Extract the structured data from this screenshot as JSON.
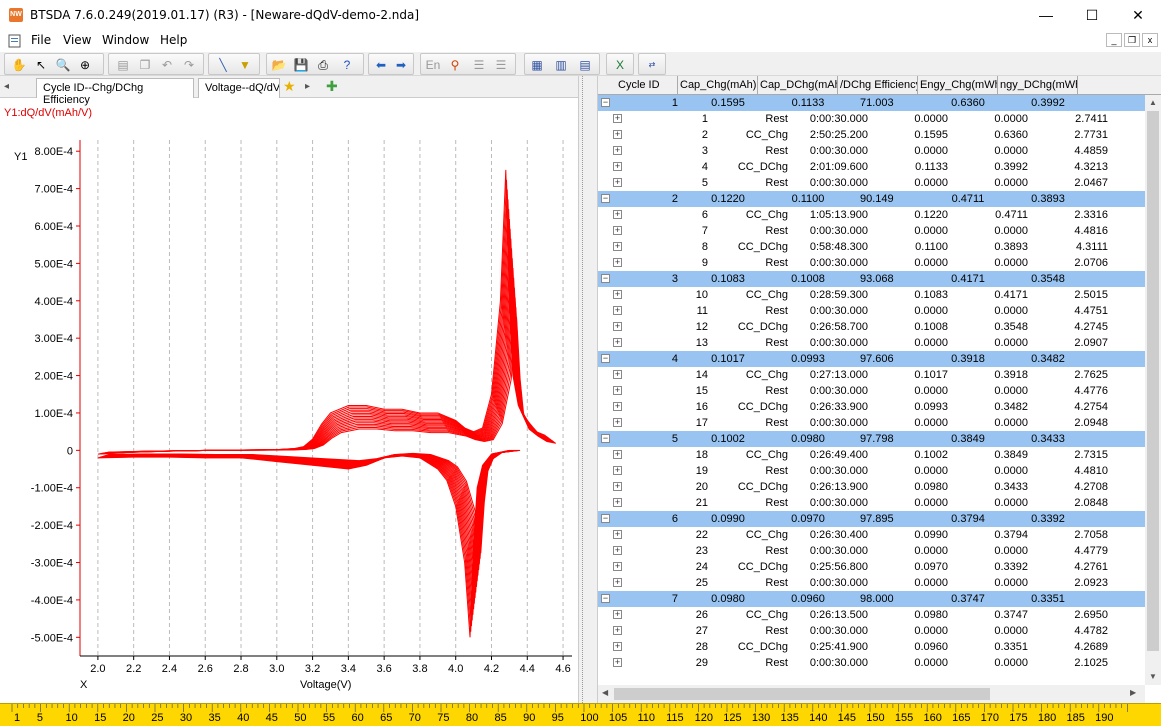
{
  "window": {
    "title": "BTSDA 7.6.0.249(2019.01.17) (R3) - [Neware-dQdV-demo-2.nda]",
    "icon_text": "NW",
    "min_glyph": "—",
    "max_glyph": "☐",
    "close_glyph": "✕"
  },
  "menu": {
    "items": [
      "File",
      "View",
      "Window",
      "Help"
    ],
    "mdi_min": "_",
    "mdi_restore": "❐",
    "mdi_close": "x"
  },
  "tabs": {
    "tab1": "Cycle ID--Chg/DChg Efficiency",
    "tab2": "Voltage--dQ/dV",
    "left_arrow": "◂",
    "right_arrow": "▸"
  },
  "chart_data": {
    "type": "line",
    "ylabel_top": "Y1:dQ/dV(mAh/V)",
    "y_axis_name": "Y1",
    "x_axis_name": "X",
    "xlabel": "Voltage(V)",
    "x_ticks": [
      "2.0",
      "2.2",
      "2.4",
      "2.6",
      "2.8",
      "3.0",
      "3.2",
      "3.4",
      "3.6",
      "3.8",
      "4.0",
      "4.2",
      "4.4",
      "4.6"
    ],
    "y_ticks": [
      "8.00E-4",
      "7.00E-4",
      "6.00E-4",
      "5.00E-4",
      "4.00E-4",
      "3.00E-4",
      "2.00E-4",
      "1.00E-4",
      "0",
      "-1.00E-4",
      "-2.00E-4",
      "-3.00E-4",
      "-4.00E-4",
      "-5.00E-4"
    ],
    "xlim": [
      1.9,
      4.65
    ],
    "ylim": [
      -0.00055,
      0.00083
    ],
    "grid": "vertical",
    "series_color": "#ff0000",
    "charge_curve": {
      "x": [
        2.0,
        2.2,
        2.4,
        2.6,
        2.8,
        3.0,
        3.1,
        3.15,
        3.2,
        3.25,
        3.3,
        3.4,
        3.5,
        3.6,
        3.7,
        3.8,
        3.9,
        4.0,
        4.05,
        4.1,
        4.15,
        4.2,
        4.22,
        4.25,
        4.28,
        4.3,
        4.32,
        4.35,
        4.4,
        4.45,
        4.5
      ],
      "y": [
        -1e-05,
        -5e-06,
        -2e-06,
        0.0,
        1e-06,
        2e-06,
        5e-06,
        1e-05,
        3e-05,
        7e-05,
        0.0001,
        0.00012,
        0.00012,
        0.00011,
        0.00011,
        0.0001,
        0.0001,
        8e-05,
        6e-05,
        5e-05,
        6e-05,
        0.00015,
        0.00025,
        0.0004,
        0.00075,
        0.0004,
        0.0002,
        0.00012,
        8e-05,
        5e-05,
        4e-05
      ]
    },
    "discharge_curve": {
      "x": [
        2.0,
        2.2,
        2.4,
        2.6,
        2.8,
        3.0,
        3.2,
        3.4,
        3.5,
        3.6,
        3.7,
        3.8,
        3.9,
        3.95,
        4.0,
        4.05,
        4.08,
        4.1,
        4.12,
        4.15,
        4.2,
        4.3
      ],
      "y": [
        -2e-05,
        -1.8e-05,
        -1.8e-05,
        -2e-05,
        -2e-05,
        -3e-05,
        -4e-05,
        -5e-05,
        -4e-05,
        -2e-05,
        -1.5e-05,
        -2e-05,
        -5e-05,
        -8e-05,
        -0.00015,
        -0.0003,
        -0.0005,
        -0.00025,
        -0.0001,
        -4e-05,
        -1e-05,
        0.0
      ]
    }
  },
  "grid": {
    "columns": [
      "Cycle ID",
      "Cap_Chg(mAh)",
      "Cap_DChg(mAh)",
      "/DChg Efficiency",
      "Engy_Chg(mWh)",
      "ngy_DChg(mWh"
    ],
    "rows": [
      {
        "type": "parent",
        "cycle": "1",
        "cap_chg": "0.1595",
        "cap_dchg": "0.1133",
        "eff": "71.003",
        "engy_chg": "0.6360",
        "engy_dchg": "0.3992"
      },
      {
        "type": "child",
        "id": "1",
        "step": "Rest",
        "time": "0:00:30.000",
        "cap": "0.0000",
        "engy": "0.0000",
        "v": "2.7411"
      },
      {
        "type": "child",
        "id": "2",
        "step": "CC_Chg",
        "time": "2:50:25.200",
        "cap": "0.1595",
        "engy": "0.6360",
        "v": "2.7731"
      },
      {
        "type": "child",
        "id": "3",
        "step": "Rest",
        "time": "0:00:30.000",
        "cap": "0.0000",
        "engy": "0.0000",
        "v": "4.4859"
      },
      {
        "type": "child",
        "id": "4",
        "step": "CC_DChg",
        "time": "2:01:09.600",
        "cap": "0.1133",
        "engy": "0.3992",
        "v": "4.3213"
      },
      {
        "type": "child",
        "id": "5",
        "step": "Rest",
        "time": "0:00:30.000",
        "cap": "0.0000",
        "engy": "0.0000",
        "v": "2.0467"
      },
      {
        "type": "parent",
        "cycle": "2",
        "cap_chg": "0.1220",
        "cap_dchg": "0.1100",
        "eff": "90.149",
        "engy_chg": "0.4711",
        "engy_dchg": "0.3893"
      },
      {
        "type": "child",
        "id": "6",
        "step": "CC_Chg",
        "time": "1:05:13.900",
        "cap": "0.1220",
        "engy": "0.4711",
        "v": "2.3316"
      },
      {
        "type": "child",
        "id": "7",
        "step": "Rest",
        "time": "0:00:30.000",
        "cap": "0.0000",
        "engy": "0.0000",
        "v": "4.4816"
      },
      {
        "type": "child",
        "id": "8",
        "step": "CC_DChg",
        "time": "0:58:48.300",
        "cap": "0.1100",
        "engy": "0.3893",
        "v": "4.3111"
      },
      {
        "type": "child",
        "id": "9",
        "step": "Rest",
        "time": "0:00:30.000",
        "cap": "0.0000",
        "engy": "0.0000",
        "v": "2.0706"
      },
      {
        "type": "parent",
        "cycle": "3",
        "cap_chg": "0.1083",
        "cap_dchg": "0.1008",
        "eff": "93.068",
        "engy_chg": "0.4171",
        "engy_dchg": "0.3548"
      },
      {
        "type": "child",
        "id": "10",
        "step": "CC_Chg",
        "time": "0:28:59.300",
        "cap": "0.1083",
        "engy": "0.4171",
        "v": "2.5015"
      },
      {
        "type": "child",
        "id": "11",
        "step": "Rest",
        "time": "0:00:30.000",
        "cap": "0.0000",
        "engy": "0.0000",
        "v": "4.4751"
      },
      {
        "type": "child",
        "id": "12",
        "step": "CC_DChg",
        "time": "0:26:58.700",
        "cap": "0.1008",
        "engy": "0.3548",
        "v": "4.2745"
      },
      {
        "type": "child",
        "id": "13",
        "step": "Rest",
        "time": "0:00:30.000",
        "cap": "0.0000",
        "engy": "0.0000",
        "v": "2.0907"
      },
      {
        "type": "parent",
        "cycle": "4",
        "cap_chg": "0.1017",
        "cap_dchg": "0.0993",
        "eff": "97.606",
        "engy_chg": "0.3918",
        "engy_dchg": "0.3482"
      },
      {
        "type": "child",
        "id": "14",
        "step": "CC_Chg",
        "time": "0:27:13.000",
        "cap": "0.1017",
        "engy": "0.3918",
        "v": "2.7625"
      },
      {
        "type": "child",
        "id": "15",
        "step": "Rest",
        "time": "0:00:30.000",
        "cap": "0.0000",
        "engy": "0.0000",
        "v": "4.4776"
      },
      {
        "type": "child",
        "id": "16",
        "step": "CC_DChg",
        "time": "0:26:33.900",
        "cap": "0.0993",
        "engy": "0.3482",
        "v": "4.2754"
      },
      {
        "type": "child",
        "id": "17",
        "step": "Rest",
        "time": "0:00:30.000",
        "cap": "0.0000",
        "engy": "0.0000",
        "v": "2.0948"
      },
      {
        "type": "parent",
        "cycle": "5",
        "cap_chg": "0.1002",
        "cap_dchg": "0.0980",
        "eff": "97.798",
        "engy_chg": "0.3849",
        "engy_dchg": "0.3433"
      },
      {
        "type": "child",
        "id": "18",
        "step": "CC_Chg",
        "time": "0:26:49.400",
        "cap": "0.1002",
        "engy": "0.3849",
        "v": "2.7315"
      },
      {
        "type": "child",
        "id": "19",
        "step": "Rest",
        "time": "0:00:30.000",
        "cap": "0.0000",
        "engy": "0.0000",
        "v": "4.4810"
      },
      {
        "type": "child",
        "id": "20",
        "step": "CC_DChg",
        "time": "0:26:13.900",
        "cap": "0.0980",
        "engy": "0.3433",
        "v": "4.2708"
      },
      {
        "type": "child",
        "id": "21",
        "step": "Rest",
        "time": "0:00:30.000",
        "cap": "0.0000",
        "engy": "0.0000",
        "v": "2.0848"
      },
      {
        "type": "parent",
        "cycle": "6",
        "cap_chg": "0.0990",
        "cap_dchg": "0.0970",
        "eff": "97.895",
        "engy_chg": "0.3794",
        "engy_dchg": "0.3392"
      },
      {
        "type": "child",
        "id": "22",
        "step": "CC_Chg",
        "time": "0:26:30.400",
        "cap": "0.0990",
        "engy": "0.3794",
        "v": "2.7058"
      },
      {
        "type": "child",
        "id": "23",
        "step": "Rest",
        "time": "0:00:30.000",
        "cap": "0.0000",
        "engy": "0.0000",
        "v": "4.4779"
      },
      {
        "type": "child",
        "id": "24",
        "step": "CC_DChg",
        "time": "0:25:56.800",
        "cap": "0.0970",
        "engy": "0.3392",
        "v": "4.2761"
      },
      {
        "type": "child",
        "id": "25",
        "step": "Rest",
        "time": "0:00:30.000",
        "cap": "0.0000",
        "engy": "0.0000",
        "v": "2.0923"
      },
      {
        "type": "parent",
        "cycle": "7",
        "cap_chg": "0.0980",
        "cap_dchg": "0.0960",
        "eff": "98.000",
        "engy_chg": "0.3747",
        "engy_dchg": "0.3351"
      },
      {
        "type": "child",
        "id": "26",
        "step": "CC_Chg",
        "time": "0:26:13.500",
        "cap": "0.0980",
        "engy": "0.3747",
        "v": "2.6950"
      },
      {
        "type": "child",
        "id": "27",
        "step": "Rest",
        "time": "0:00:30.000",
        "cap": "0.0000",
        "engy": "0.0000",
        "v": "4.4782"
      },
      {
        "type": "child",
        "id": "28",
        "step": "CC_DChg",
        "time": "0:25:41.900",
        "cap": "0.0960",
        "engy": "0.3351",
        "v": "4.2689"
      },
      {
        "type": "child",
        "id": "29",
        "step": "Rest",
        "time": "0:00:30.000",
        "cap": "0.0000",
        "engy": "0.0000",
        "v": "2.1025"
      }
    ]
  },
  "ruler": {
    "labels": [
      "1",
      "5",
      "10",
      "15",
      "20",
      "25",
      "30",
      "35",
      "40",
      "45",
      "50",
      "55",
      "60",
      "65",
      "70",
      "75",
      "80",
      "85",
      "90",
      "95",
      "100",
      "105",
      "110",
      "115",
      "120",
      "125",
      "130",
      "135",
      "140",
      "145",
      "150",
      "155",
      "160",
      "165",
      "170",
      "175",
      "180",
      "185",
      "190"
    ]
  },
  "colors": {
    "accent_row": "#99c4f2",
    "curve": "#ff0000",
    "ruler_bg": "#ffd700"
  }
}
